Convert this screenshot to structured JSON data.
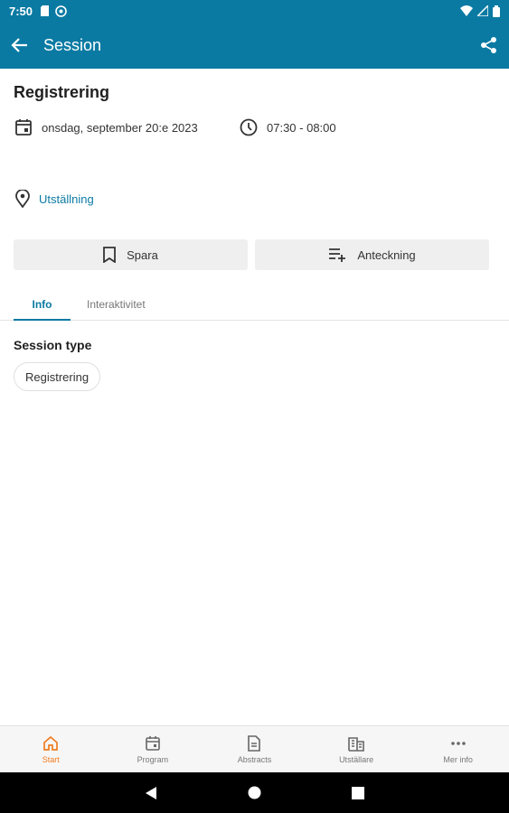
{
  "status_bar": {
    "time": "7:50"
  },
  "app_bar": {
    "title": "Session"
  },
  "session": {
    "title": "Registrering",
    "date": "onsdag, september 20:e 2023",
    "time": "07:30 - 08:00",
    "location": "Utställning"
  },
  "actions": {
    "save_label": "Spara",
    "note_label": "Anteckning"
  },
  "tabs": [
    {
      "label": "Info",
      "active": true
    },
    {
      "label": "Interaktivitet",
      "active": false
    }
  ],
  "details": {
    "session_type_heading": "Session type",
    "session_type_value": "Registrering"
  },
  "bottom_nav": [
    {
      "label": "Start",
      "icon": "home-icon",
      "active": true
    },
    {
      "label": "Program",
      "icon": "calendar-icon",
      "active": false
    },
    {
      "label": "Abstracts",
      "icon": "document-icon",
      "active": false
    },
    {
      "label": "Utställare",
      "icon": "building-icon",
      "active": false
    },
    {
      "label": "Mer info",
      "icon": "more-icon",
      "active": false
    }
  ],
  "colors": {
    "primary": "#0a7aa3",
    "accent": "#f07d21"
  }
}
